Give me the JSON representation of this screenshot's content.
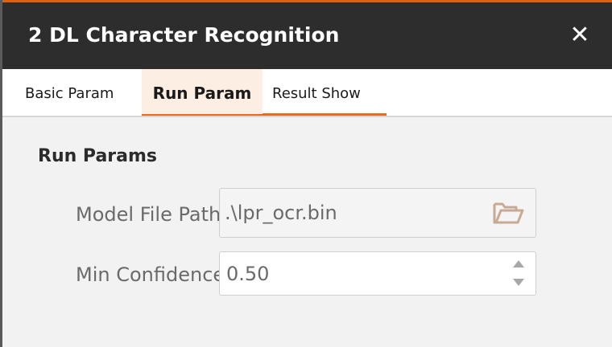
{
  "window": {
    "title": "2 DL Character Recognition",
    "close_glyph": "✕"
  },
  "tabs": [
    {
      "label": "Basic Param",
      "active": false
    },
    {
      "label": "Run Param",
      "active": true
    },
    {
      "label": "Result Show",
      "active": false
    }
  ],
  "section": {
    "title": "Run Params"
  },
  "fields": {
    "model_file": {
      "label": "Model File Path",
      "value": ".\\lpr_ocr.bin",
      "icon": "folder-open-icon"
    },
    "min_confidence": {
      "label": "Min Confidence",
      "value": "0.50",
      "icon": "spin-arrows-icon"
    }
  },
  "colors": {
    "accent": "#ea6a1a",
    "titlebar_bg": "#2d2d2d",
    "active_tab_bg": "#fdeee3",
    "folder_icon": "#c8aa94"
  }
}
